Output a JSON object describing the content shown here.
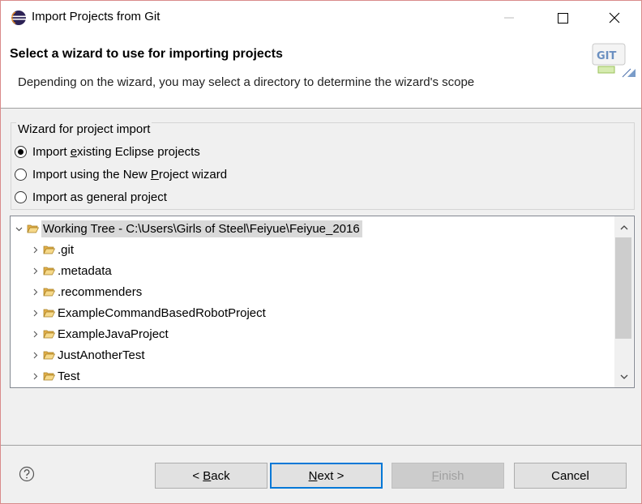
{
  "window": {
    "title": "Import Projects from Git",
    "controls": {
      "minimize_icon": "minimize-icon",
      "maximize_icon": "maximize-icon",
      "close_icon": "close-icon"
    }
  },
  "header": {
    "title": "Select a wizard to use for importing projects",
    "description": "Depending on the wizard, you may select a directory to determine the wizard's scope",
    "banner_text": "GIT"
  },
  "wizard_group": {
    "legend": "Wizard for project import",
    "options": [
      {
        "pre": "Import ",
        "mnemonic": "e",
        "post": "xisting Eclipse projects",
        "selected": true
      },
      {
        "pre": "Import using the New ",
        "mnemonic": "P",
        "post": "roject wizard",
        "selected": false
      },
      {
        "pre": "Import as ",
        "mnemonic": "g",
        "post": "eneral project",
        "selected": false
      }
    ]
  },
  "tree": {
    "root": "Working Tree - C:\\Users\\Girls of Steel\\Feiyue\\Feiyue_2016",
    "children": [
      ".git",
      ".metadata",
      ".recommenders",
      "ExampleCommandBasedRobotProject",
      "ExampleJavaProject",
      "JustAnotherTest",
      "Test"
    ]
  },
  "buttons": {
    "back": {
      "label": "Back",
      "prefix": "< ",
      "mnemonic": "B",
      "rest": "ack"
    },
    "next": {
      "label": "Next",
      "mnemonic": "N",
      "rest": "ext >"
    },
    "finish": {
      "label": "Finish",
      "mnemonic": "F",
      "rest": "inish",
      "enabled": false
    },
    "cancel": {
      "label": "Cancel"
    }
  },
  "colors": {
    "accent": "#0078d7",
    "selection": "#d9d9d9",
    "folder": "#e3b04b"
  }
}
